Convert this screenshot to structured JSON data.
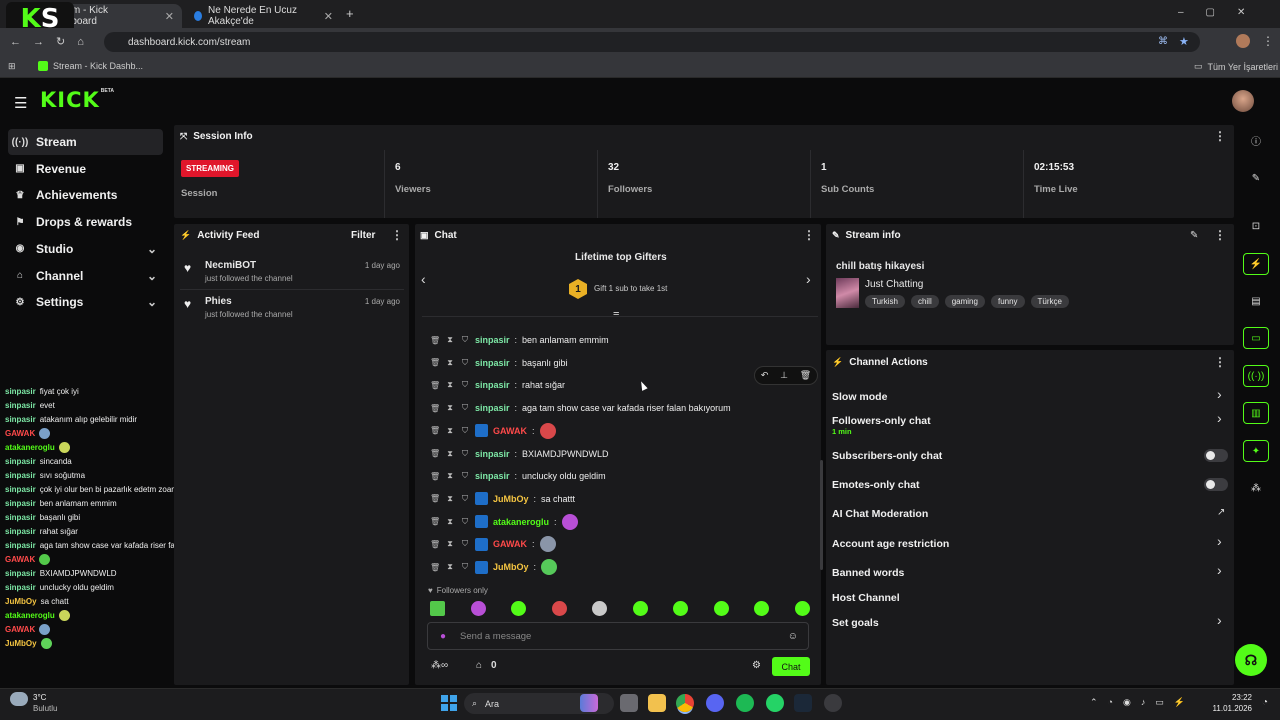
{
  "browser": {
    "tabs": [
      {
        "title": "Stream - Kick Dashboard",
        "active": true
      },
      {
        "title": "Ne Nerede En Ucuz Akakçe'de",
        "active": false
      }
    ],
    "new_tab": "+",
    "url": "dashboard.kick.com/stream",
    "bookmark": "Stream - Kick Dashb...",
    "all_bookmarks": "Tüm Yer İşaretleri"
  },
  "header": {
    "logo": "KICK",
    "logo_tag": "BETA"
  },
  "sidebar": {
    "items": [
      {
        "label": "Stream",
        "icon": "broadcast-icon",
        "active": true
      },
      {
        "label": "Revenue",
        "icon": "revenue-icon"
      },
      {
        "label": "Achievements",
        "icon": "trophy-icon"
      },
      {
        "label": "Drops & rewards",
        "icon": "gift-icon"
      },
      {
        "label": "Studio",
        "icon": "studio-icon",
        "expandable": true
      },
      {
        "label": "Channel",
        "icon": "channel-icon",
        "expandable": true
      },
      {
        "label": "Settings",
        "icon": "gear-icon",
        "expandable": true
      }
    ]
  },
  "overlay_chat": [
    {
      "user": "sinpasir",
      "color": "#7de8a6",
      "text": "fiyat çok iyi"
    },
    {
      "user": "sinpasir",
      "color": "#7de8a6",
      "text": "evet"
    },
    {
      "user": "sinpasir",
      "color": "#7de8a6",
      "text": "atakanım alıp gelebilir midir"
    },
    {
      "user": "GAWAK",
      "color": "#ff4a4a",
      "text": "",
      "emote": "#7aa0c8"
    },
    {
      "user": "atakaneroglu",
      "color": "#53fc18",
      "text": "",
      "emote": "#c9d65a"
    },
    {
      "user": "sinpasir",
      "color": "#7de8a6",
      "text": "sincanda"
    },
    {
      "user": "sinpasir",
      "color": "#7de8a6",
      "text": "sıvı soğutma"
    },
    {
      "user": "sinpasir",
      "color": "#7de8a6",
      "text": "çok iyi olur ben bi pazarlık edetm zoaman"
    },
    {
      "user": "sinpasir",
      "color": "#7de8a6",
      "text": "ben anlamam emmim"
    },
    {
      "user": "sinpasir",
      "color": "#7de8a6",
      "text": "başanlı gibi"
    },
    {
      "user": "sinpasir",
      "color": "#7de8a6",
      "text": "rahat sığar"
    },
    {
      "user": "sinpasir",
      "color": "#7de8a6",
      "text": "aga tam show case var kafada riser falan bakıyorum"
    },
    {
      "user": "GAWAK",
      "color": "#ff4a4a",
      "text": "",
      "emote": "#53c94a"
    },
    {
      "user": "sinpasir",
      "color": "#7de8a6",
      "text": "BXIAMDJPWNDWLD"
    },
    {
      "user": "sinpasir",
      "color": "#7de8a6",
      "text": "unclucky oldu geldim"
    },
    {
      "user": "JuMbOy",
      "color": "#f5c542",
      "text": "sa chatt"
    },
    {
      "user": "atakaneroglu",
      "color": "#53fc18",
      "text": "",
      "emote": "#c9d65a"
    },
    {
      "user": "GAWAK",
      "color": "#ff4a4a",
      "text": "",
      "emote": "#7aa0c8"
    },
    {
      "user": "JuMbOy",
      "color": "#f5c542",
      "text": "",
      "emote": "#5fd35a"
    }
  ],
  "session": {
    "title": "Session Info",
    "status_badge": "STREAMING",
    "status_label": "Session",
    "stats": [
      {
        "value": "6",
        "label": "Viewers"
      },
      {
        "value": "32",
        "label": "Followers"
      },
      {
        "value": "1",
        "label": "Sub Counts"
      },
      {
        "value": "02:15:53",
        "label": "Time Live"
      }
    ]
  },
  "activity": {
    "title": "Activity Feed",
    "filter": "Filter",
    "items": [
      {
        "name": "NecmiBOT",
        "action": "just followed the channel",
        "time": "1 day ago"
      },
      {
        "name": "Phies",
        "action": "just followed the channel",
        "time": "1 day ago"
      }
    ]
  },
  "chat": {
    "title": "Chat",
    "gifters_title": "Lifetime top Gifters",
    "gift_rank": "1",
    "gift_prompt": "Gift 1 sub to take 1st",
    "messages": [
      {
        "user": "sinpasir",
        "color": "#7de8a6",
        "text": "ben anlamam emmim",
        "badge": false
      },
      {
        "user": "sinpasir",
        "color": "#7de8a6",
        "text": "başanlı gibi",
        "badge": false
      },
      {
        "user": "sinpasir",
        "color": "#7de8a6",
        "text": "rahat sığar",
        "badge": false
      },
      {
        "user": "sinpasir",
        "color": "#7de8a6",
        "text": "aga tam show case var kafada riser falan bakıyorum",
        "badge": false
      },
      {
        "user": "GAWAK",
        "color": "#ff4a4a",
        "text": "",
        "badge": true,
        "emote": "#d9484a"
      },
      {
        "user": "sinpasir",
        "color": "#7de8a6",
        "text": "BXIAMDJPWNDWLD",
        "badge": false
      },
      {
        "user": "sinpasir",
        "color": "#7de8a6",
        "text": "unclucky oldu geldim",
        "badge": false
      },
      {
        "user": "JuMbOy",
        "color": "#f5c542",
        "text": "sa chattt",
        "badge": true
      },
      {
        "user": "atakaneroglu",
        "color": "#53fc18",
        "text": "",
        "badge": true,
        "emote": "#b84fd6"
      },
      {
        "user": "GAWAK",
        "color": "#ff4a4a",
        "text": "",
        "badge": true,
        "emote": "#8a95a8"
      },
      {
        "user": "JuMbOy",
        "color": "#f5c542",
        "text": "",
        "badge": true,
        "emote": "#56c95a"
      }
    ],
    "mode_label": "Followers only",
    "emote_bar": [
      "#53c94a",
      "#b84fd6",
      "#53fc18",
      "#d9484a",
      "#c9c9c9",
      "#53fc18",
      "#53fc18",
      "#53fc18",
      "#53fc18",
      "#53fc18"
    ],
    "input_placeholder": "Send a message",
    "points": "0",
    "send_label": "Chat"
  },
  "stream_info": {
    "title": "Stream info",
    "stream_title": "chill batış hikayesi",
    "category": "Just Chatting",
    "tags": [
      "Turkish",
      "chill",
      "gaming",
      "funny",
      "Türkçe"
    ]
  },
  "channel_actions": {
    "title": "Channel Actions",
    "items": [
      {
        "label": "Slow mode",
        "control": "arrow"
      },
      {
        "label": "Followers-only chat",
        "sub": "1 min",
        "control": "arrow"
      },
      {
        "label": "Subscribers-only chat",
        "control": "toggle",
        "on": false
      },
      {
        "label": "Emotes-only chat",
        "control": "toggle",
        "on": false
      },
      {
        "label": "AI Chat Moderation",
        "control": "external"
      },
      {
        "label": "Account age restriction",
        "control": "arrow"
      },
      {
        "label": "Banned words",
        "control": "arrow"
      },
      {
        "label": "Host Channel",
        "control": "none"
      },
      {
        "label": "Set goals",
        "control": "arrow"
      }
    ]
  },
  "taskbar": {
    "weather_temp": "3°C",
    "weather_desc": "Bulutlu",
    "search": "Ara",
    "time": "23:22",
    "date": "11.01.2026"
  },
  "colors": {
    "brand": "#53fc18",
    "live": "#e0162b",
    "panel": "#1a1a1c",
    "bg": "#0b0b0c"
  }
}
